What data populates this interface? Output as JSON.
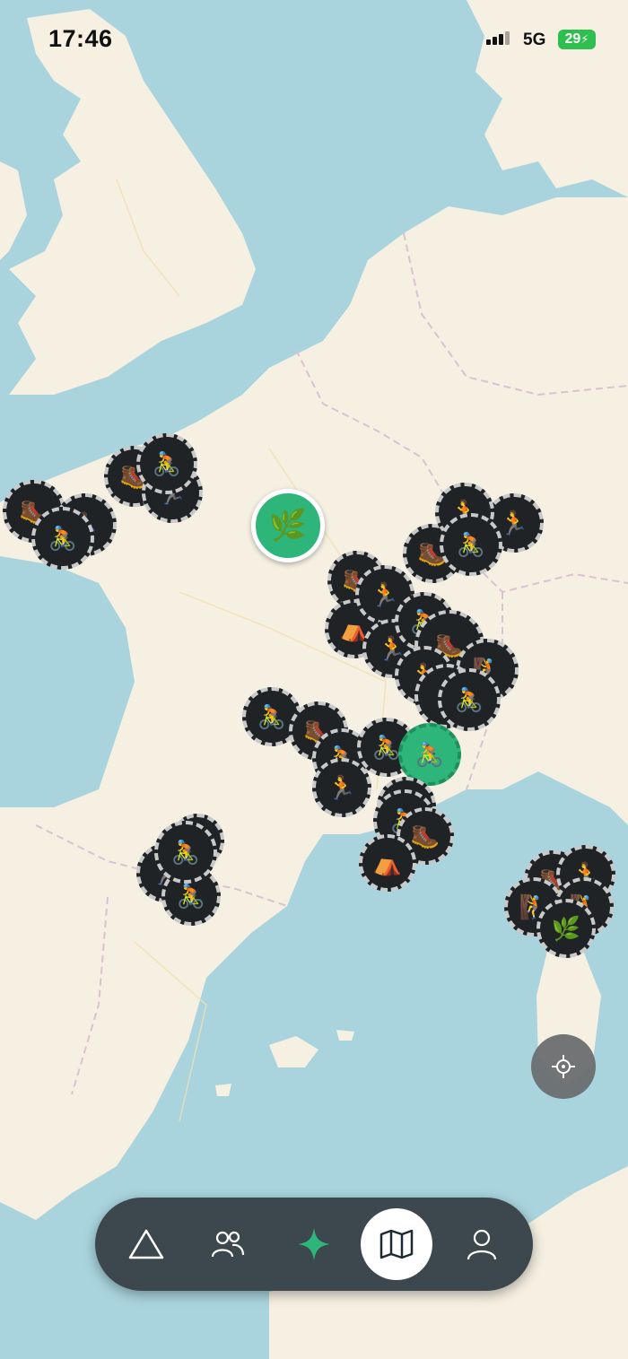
{
  "status_bar": {
    "time": "17:46",
    "network": "5G",
    "battery": "29"
  },
  "map": {
    "colors": {
      "water": "#a9d4de",
      "land": "#f6f0e2",
      "border": "#c9b9c9"
    },
    "markers": [
      {
        "icon": "hiking-boot",
        "emoji": "🥾",
        "style": "dark"
      },
      {
        "icon": "cyclist",
        "emoji": "🚴",
        "style": "dark"
      },
      {
        "icon": "runner",
        "emoji": "🏃",
        "style": "dark"
      },
      {
        "icon": "herb-leaf",
        "emoji": "🌿",
        "style": "green"
      },
      {
        "icon": "camping-tent",
        "emoji": "⛺",
        "style": "dark"
      },
      {
        "icon": "climbing",
        "emoji": "🧗",
        "style": "dark"
      }
    ]
  },
  "bottom_nav": {
    "items": [
      {
        "icon": "triangle-icon",
        "active": false
      },
      {
        "icon": "people-icon",
        "active": false
      },
      {
        "icon": "sparkle-icon",
        "active": false
      },
      {
        "icon": "map-icon",
        "active": true
      },
      {
        "icon": "profile-icon",
        "active": false
      }
    ]
  },
  "accent_color": "#2db57a"
}
